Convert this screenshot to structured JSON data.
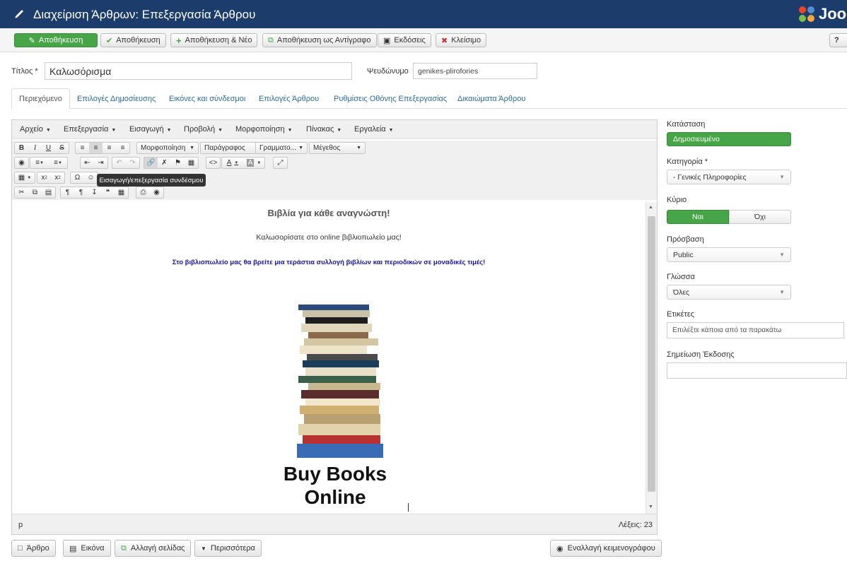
{
  "header": {
    "title": "Διαχείριση Άρθρων: Επεξεργασία Άρθρου",
    "logo_text": "Joo"
  },
  "toolbar": {
    "save_edit": "Αποθήκευση",
    "save": "Αποθήκευση",
    "save_new": "Αποθήκευση & Νέο",
    "save_copy": "Αποθήκευση ως Αντίγραφο",
    "versions": "Εκδόσεις",
    "close": "Κλείσιμο",
    "help": "?"
  },
  "form": {
    "title_label": "Τίτλος *",
    "title_value": "Καλωσόρισμα",
    "alias_label": "Ψευδώνυμο",
    "alias_value": "genikes-plirofories"
  },
  "tabs": [
    {
      "label": "Περιεχόμενο"
    },
    {
      "label": "Επιλογές Δημοσίευσης"
    },
    {
      "label": "Εικόνες και σύνδεσμοι"
    },
    {
      "label": "Επιλογές Άρθρου"
    },
    {
      "label": "Ρυθμίσεις Οθόνης Επεξεργασίας"
    },
    {
      "label": "Δικαιώματα Άρθρου"
    }
  ],
  "editor": {
    "menus": [
      "Αρχείο",
      "Επεξεργασία",
      "Εισαγωγή",
      "Προβολή",
      "Μορφοποίηση",
      "Πίνακας",
      "Εργαλεία"
    ],
    "format_select": "Μορφοποίηση",
    "paragraph_select": "Παράγραφος",
    "font_select": "Γραμματο...",
    "size_select": "Μέγεθος",
    "tooltip": "Εισαγωγή/επεξεργασία συνδέσμου",
    "content": {
      "heading": "Βιβλία για κάθε αναγνώστη!",
      "welcome": "Καλωσορίσατε στο online βιβλιοπωλείο μας!",
      "blurb": "Στο βιβλιοπωλείο μας θα βρείτε μια τεράστια συλλογή βιβλίων και περιοδικών σε μοναδικές τιμές!",
      "image_line1": "Buy Books",
      "image_line2": "Online"
    },
    "status_path": "p",
    "word_count": "Λέξεις: 23"
  },
  "bottom_buttons": {
    "article": "Άρθρο",
    "image": "Εικόνα",
    "page_break": "Αλλαγή σελίδας",
    "more": "Περισσότερα",
    "toggle_editor": "Εναλλαγή κειμενογράφου"
  },
  "sidebar": {
    "status_label": "Κατάσταση",
    "status_value": "Δημοσιευμένο",
    "category_label": "Κατηγορία *",
    "category_value": "- Γενικές Πληροφορίες",
    "featured_label": "Κύριο",
    "featured_yes": "Ναι",
    "featured_no": "Όχι",
    "access_label": "Πρόσβαση",
    "access_value": "Public",
    "language_label": "Γλώσσα",
    "language_value": "Όλες",
    "tags_label": "Ετικέτες",
    "tags_placeholder": "Επιλέξτε κάποια από τα παρακάτω",
    "version_note_label": "Σημείωση Έκδοσης",
    "version_note_value": ""
  },
  "colors": {
    "header_bg": "#1c3d6b",
    "success_green": "#46a546",
    "link_blue": "#2a6ba5",
    "blurb_blue": "#1414b4"
  }
}
